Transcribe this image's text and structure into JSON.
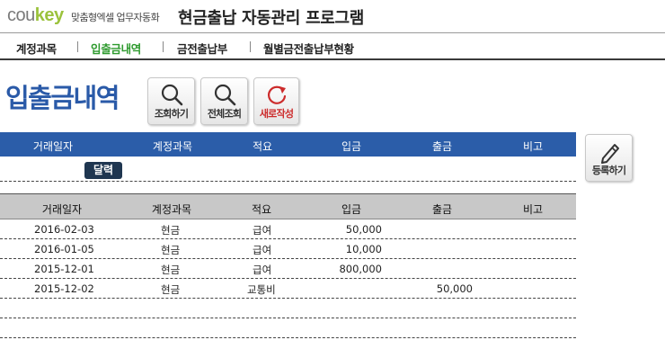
{
  "header": {
    "logo_part1": "cou",
    "logo_part2": "key",
    "logo_tagline": "맞춤형엑셀 업무자동화",
    "title": "현금출납 자동관리 프로그램"
  },
  "tabs": [
    {
      "label": "계정과목",
      "active": false
    },
    {
      "label": "입출금내역",
      "active": true
    },
    {
      "label": "금전출납부",
      "active": false
    },
    {
      "label": "월별금전출납부현황",
      "active": false
    }
  ],
  "page_title": "입출금내역",
  "toolbar": {
    "search_label": "조회하기",
    "search_all_label": "전체조회",
    "new_label": "새로작성",
    "register_label": "등록하기"
  },
  "input_form": {
    "columns": [
      "거래일자",
      "계정과목",
      "적요",
      "입금",
      "출금",
      "비고"
    ],
    "calendar_label": "달력"
  },
  "list": {
    "columns": [
      "거래일자",
      "계정과목",
      "적요",
      "입금",
      "출금",
      "비고"
    ],
    "rows": [
      {
        "date": "2016-02-03",
        "account": "현금",
        "desc": "급여",
        "deposit": "50,000",
        "withdraw": "",
        "note": ""
      },
      {
        "date": "2016-01-05",
        "account": "현금",
        "desc": "급여",
        "deposit": "10,000",
        "withdraw": "",
        "note": ""
      },
      {
        "date": "2015-12-01",
        "account": "현금",
        "desc": "급여",
        "deposit": "800,000",
        "withdraw": "",
        "note": ""
      },
      {
        "date": "2015-12-02",
        "account": "현금",
        "desc": "교통비",
        "deposit": "",
        "withdraw": "50,000",
        "note": ""
      },
      {
        "date": "",
        "account": "",
        "desc": "",
        "deposit": "",
        "withdraw": "",
        "note": ""
      },
      {
        "date": "",
        "account": "",
        "desc": "",
        "deposit": "",
        "withdraw": "",
        "note": ""
      }
    ]
  },
  "colors": {
    "accent_blue": "#2b5da9",
    "title_blue": "#2a5aa8",
    "active_tab_green": "#2e9a2e",
    "logo_green": "#9bc23c",
    "refresh_red": "#cc2b2b"
  }
}
